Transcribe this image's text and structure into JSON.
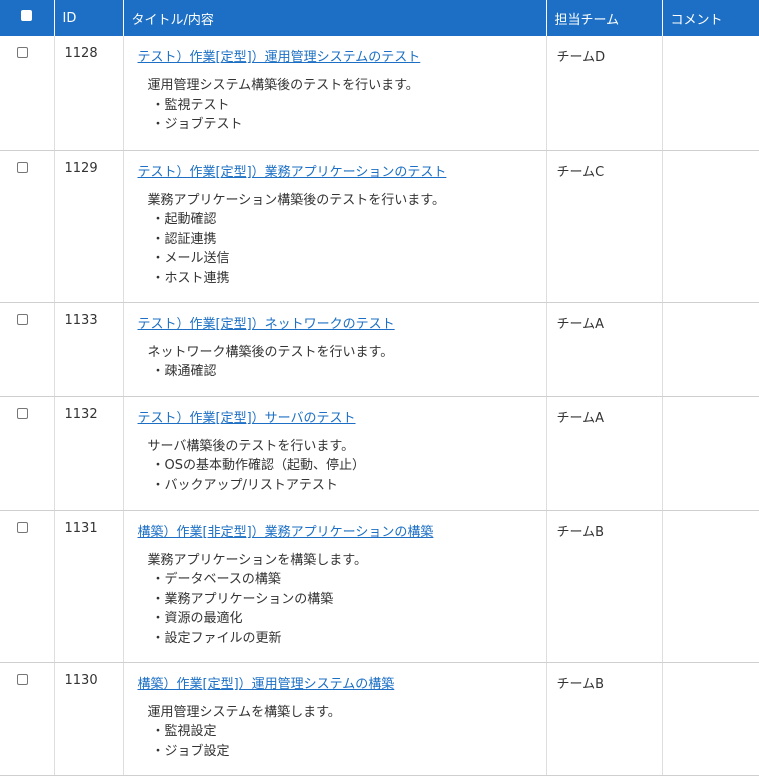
{
  "table": {
    "headers": {
      "id": "ID",
      "title": "タイトル/内容",
      "team": "担当チーム",
      "comment": "コメント"
    },
    "rows": [
      {
        "id": "1128",
        "title": "テスト）作業[定型]）運用管理システムのテスト",
        "description": "運用管理システム構築後のテストを行います。",
        "bullets": [
          "・監視テスト",
          "・ジョブテスト"
        ],
        "team": "チームD",
        "comment": ""
      },
      {
        "id": "1129",
        "title": "テスト）作業[定型]）業務アプリケーションのテスト",
        "description": "業務アプリケーション構築後のテストを行います。",
        "bullets": [
          "・起動確認",
          "・認証連携",
          "・メール送信",
          "・ホスト連携"
        ],
        "team": "チームC",
        "comment": ""
      },
      {
        "id": "1133",
        "title": "テスト）作業[定型]）ネットワークのテスト",
        "description": "ネットワーク構築後のテストを行います。",
        "bullets": [
          "・疎通確認"
        ],
        "team": "チームA",
        "comment": ""
      },
      {
        "id": "1132",
        "title": "テスト）作業[定型]）サーバのテスト",
        "description": "サーバ構築後のテストを行います。",
        "bullets": [
          "・OSの基本動作確認（起動、停止）",
          "・バックアップ/リストアテスト"
        ],
        "team": "チームA",
        "comment": ""
      },
      {
        "id": "1131",
        "title": "構築）作業[非定型]）業務アプリケーションの構築",
        "description": "業務アプリケーションを構築します。",
        "bullets": [
          "・データベースの構築",
          "・業務アプリケーションの構築",
          "・資源の最適化",
          "・設定ファイルの更新"
        ],
        "team": "チームB",
        "comment": ""
      },
      {
        "id": "1130",
        "title": "構築）作業[定型]）運用管理システムの構築",
        "description": "運用管理システムを構築します。",
        "bullets": [
          "・監視設定",
          "・ジョブ設定"
        ],
        "team": "チームB",
        "comment": ""
      }
    ]
  }
}
